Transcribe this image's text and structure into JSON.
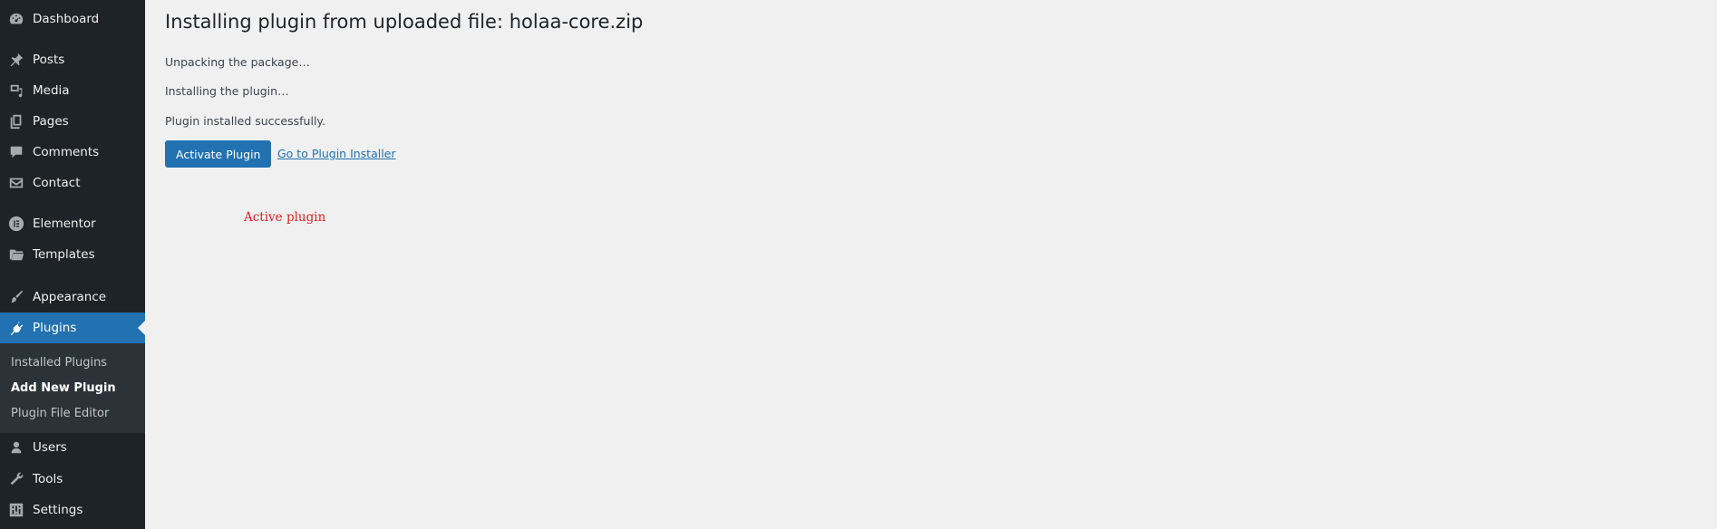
{
  "sidebar": {
    "items": [
      {
        "label": "Dashboard",
        "icon": "dashboard-icon"
      },
      {
        "label": "Posts",
        "icon": "pin-icon"
      },
      {
        "label": "Media",
        "icon": "media-icon"
      },
      {
        "label": "Pages",
        "icon": "pages-icon"
      },
      {
        "label": "Comments",
        "icon": "comment-icon"
      },
      {
        "label": "Contact",
        "icon": "mail-icon"
      },
      {
        "label": "Elementor",
        "icon": "elementor-icon"
      },
      {
        "label": "Templates",
        "icon": "folder-icon"
      },
      {
        "label": "Appearance",
        "icon": "brush-icon"
      },
      {
        "label": "Plugins",
        "icon": "plugin-icon"
      },
      {
        "label": "Users",
        "icon": "user-icon"
      },
      {
        "label": "Tools",
        "icon": "wrench-icon"
      },
      {
        "label": "Settings",
        "icon": "settings-icon"
      }
    ],
    "submenu": [
      {
        "label": "Installed Plugins"
      },
      {
        "label": "Add New Plugin"
      },
      {
        "label": "Plugin File Editor"
      }
    ]
  },
  "main": {
    "title": "Installing plugin from uploaded file: holaa-core.zip",
    "steps": [
      "Unpacking the package…",
      "Installing the plugin…",
      "Plugin installed successfully."
    ],
    "activate_label": "Activate Plugin",
    "installer_link": "Go to Plugin Installer",
    "annotation": "Active plugin"
  },
  "colors": {
    "sidebar_bg": "#1d2327",
    "submenu_bg": "#2c3338",
    "accent": "#2271b1",
    "page_bg": "#f0f0f1",
    "annotation": "#e01e1e"
  }
}
